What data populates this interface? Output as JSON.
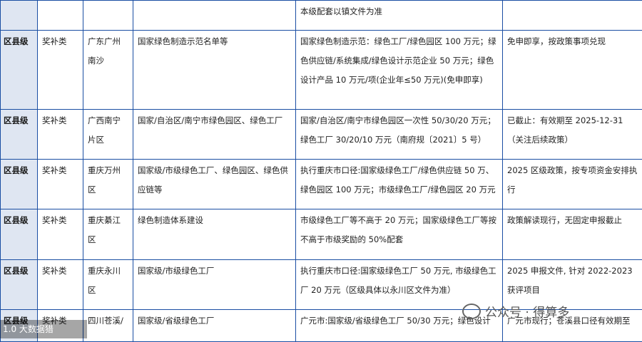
{
  "rows": [
    {
      "level": "",
      "type": "",
      "region": "",
      "scope": "",
      "standard": "本级配套以镇文件为准",
      "status": ""
    },
    {
      "level": "区县级",
      "type": "奖补类",
      "region": "广东广州南沙",
      "scope": "国家绿色制造示范名单等",
      "standard": "国家绿色制造示范：绿色工厂/绿色园区 100 万元；绿色供应链/系统集成/绿色设计示范企业 50 万元；绿色设计产品 10 万元/项(企业年≤50 万元)(免申即享)",
      "status": "免申即享，按政策事项兑现"
    },
    {
      "level": "区县级",
      "type": "奖补类",
      "region": "广西南宁片区",
      "scope": "国家/自治区/南宁市绿色园区、绿色工厂",
      "standard": "国家/自治区/南宁市绿色园区一次性 50/30/20 万元；绿色工厂 30/20/10 万元（南府规〔2021〕5 号）",
      "status": "已截止：有效期至 2025-12-31（关注后续政策）"
    },
    {
      "level": "区县级",
      "type": "奖补类",
      "region": "重庆万州区",
      "scope": "国家级/市级绿色工厂、绿色园区、绿色供应链等",
      "standard": "执行重庆市口径:国家级绿色工厂/绿色供应链 50 万、绿色园区 100 万元；市级绿色工厂/绿色园区 20 万元",
      "status": "2025 区级政策，按专项资金安排执行"
    },
    {
      "level": "区县级",
      "type": "奖补类",
      "region": "重庆綦江区",
      "scope": "绿色制造体系建设",
      "standard": "市级绿色工厂等不高于 20 万元；国家级绿色工厂等按不高于市级奖励的 50%配套",
      "status": "政策解读现行，无固定申报截止"
    },
    {
      "level": "区县级",
      "type": "奖补类",
      "region": "重庆永川区",
      "scope": "国家级/市级绿色工厂",
      "standard": "执行重庆市口径:国家级绿色工厂 50 万元, 市级绿色工厂 20 万元（区级具体以永川区文件为准）",
      "status": "2025 申报文件, 针对 2022-2023 获评项目"
    },
    {
      "level": "区县级",
      "type": "奖补类",
      "region": "四川苍溪/",
      "scope": "国家级/省级绿色工厂",
      "standard": "广元市:国家级/省级绿色工厂 50/30 万元；绿色设计",
      "status": "广元市现行；苍溪县口径有效期至"
    }
  ],
  "watermark_left": "1.0 大数据猎",
  "watermark_right": "公众号 · 得算多"
}
